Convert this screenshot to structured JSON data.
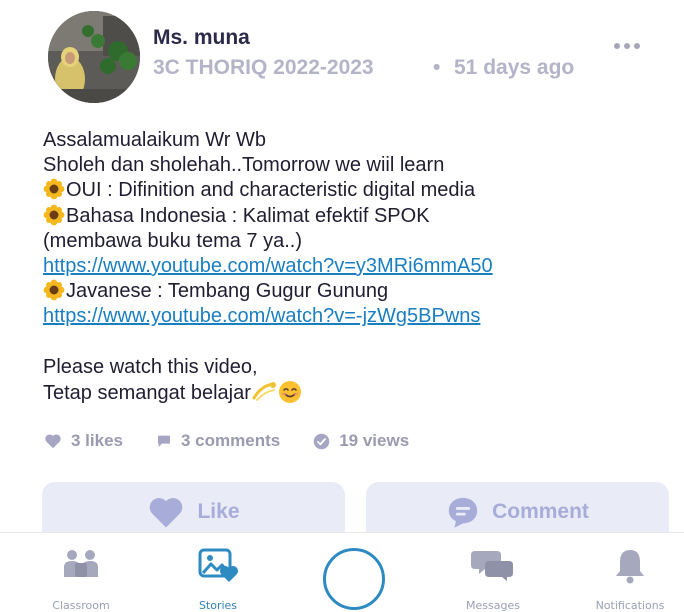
{
  "post": {
    "author": "Ms. muna",
    "class_name": "3C THORIQ 2022-2023",
    "separator": "•",
    "time_ago": "51 days ago",
    "body": {
      "line1": "Assalamualaikum Wr Wb",
      "line2": "Sholeh dan sholehah..Tomorrow we wiil learn",
      "line3": "OUI : Difinition and characteristic digital media",
      "line4": "Bahasa Indonesia : Kalimat efektif SPOK",
      "line5": "(membawa buku tema 7 ya..)",
      "link1": "https://www.youtube.com/watch?v=y3MRi6mmA50",
      "line6": "Javanese : Tembang Gugur Gunung",
      "link2": "https://www.youtube.com/watch?v=-jzWg5BPwns",
      "line7": "Please watch this video,",
      "line8": "Tetap semangat belajar"
    },
    "stats": {
      "likes": "3 likes",
      "comments": "3 comments",
      "views": "19 views"
    },
    "actions": {
      "like": "Like",
      "comment": "Comment"
    }
  },
  "nav": {
    "classroom": "Classroom",
    "stories": "Stories",
    "messages": "Messages",
    "notifications": "Notifications"
  },
  "colors": {
    "accent": "#2d8bc2",
    "muted": "#b4b4c8",
    "action_bg": "#e9ebf6",
    "action_text": "#a8acd8",
    "link": "#1a7fc1"
  }
}
